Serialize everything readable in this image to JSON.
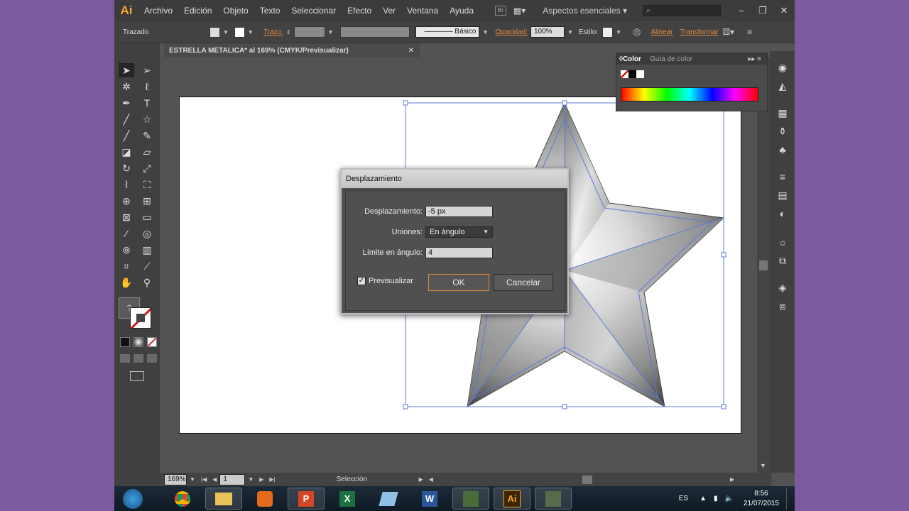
{
  "menubar": {
    "logo": "Ai",
    "items": [
      "Archivo",
      "Edición",
      "Objeto",
      "Texto",
      "Seleccionar",
      "Efecto",
      "Ver",
      "Ventana",
      "Ayuda"
    ],
    "bridge": "Br",
    "workspace": "Aspectos esenciales",
    "search_placeholder": "",
    "window_buttons": [
      "−",
      "❐",
      "✕"
    ]
  },
  "controlbar": {
    "object_type": "Trazado",
    "stroke_label": "Trazo:",
    "profile": "Básico",
    "opacity_label": "Opacidad:",
    "opacity_value": "100%",
    "style_label": "Estilo:",
    "align_link": "Alinear",
    "transform_link": "Transformar"
  },
  "document_tab": {
    "title": "ESTRELLA METALICA* al 169% (CMYK/Previsualizar)",
    "close": "✕"
  },
  "color_panel": {
    "tab_color": "Color",
    "tab_guide": "Guía de color"
  },
  "dialog": {
    "title": "Desplazamiento",
    "offset_label": "Desplazamiento:",
    "offset_value": "-5 px",
    "joins_label": "Uniones:",
    "joins_value": "En ángulo",
    "miter_label": "Límite en ángulo:",
    "miter_value": "4",
    "preview_label": "Previsualizar",
    "preview_checked": true,
    "ok_label": "OK",
    "cancel_label": "Cancelar"
  },
  "statusbar": {
    "zoom": "169%",
    "artboard_number": "1",
    "tool_status": "Selección"
  },
  "taskbar": {
    "language": "ES",
    "time": "8:56",
    "date": "21/07/2015",
    "apps": [
      "Chrome",
      "Explorador",
      "Media",
      "PowerPoint",
      "Excel",
      "App",
      "Word",
      "App",
      "Illustrator",
      "App"
    ]
  },
  "colors": {
    "accent_orange": "#e8893b",
    "ai_logo": "#f7a531",
    "selection_blue": "#5a7bdc",
    "desktop_purple": "#7b5aa0"
  }
}
